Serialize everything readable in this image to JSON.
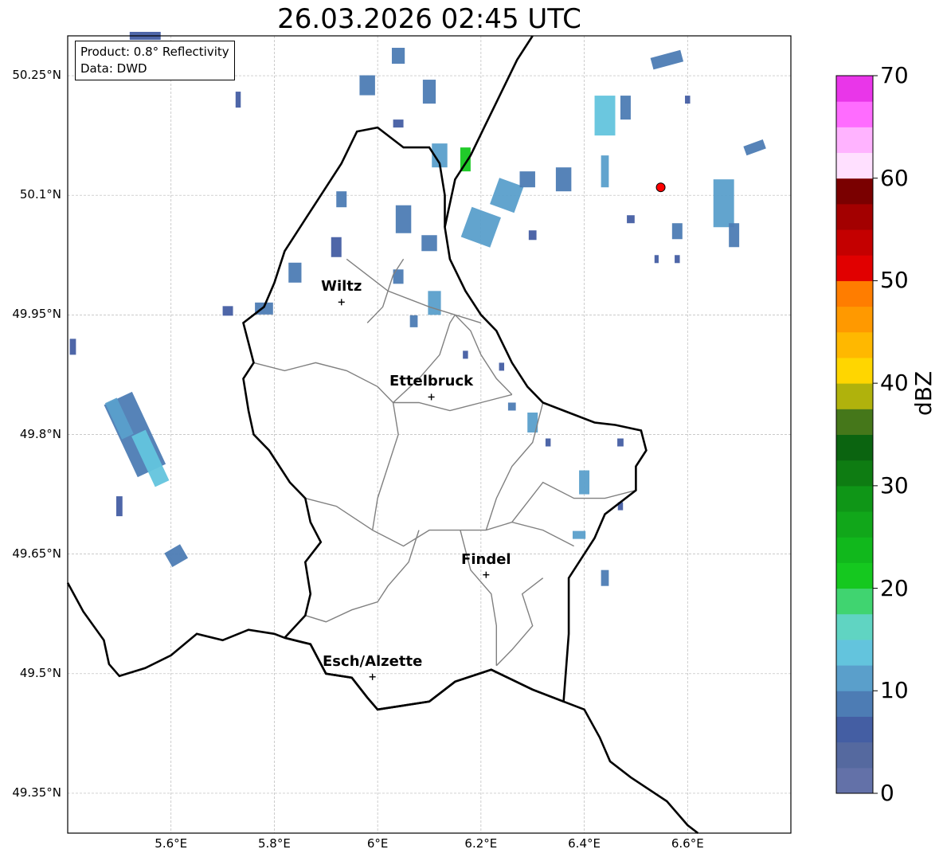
{
  "title": "26.03.2026 02:45 UTC",
  "info": {
    "product": "Product: 0.8° Reflectivity",
    "data": "Data: DWD"
  },
  "map": {
    "lon_range": [
      5.4,
      6.8
    ],
    "lat_range": [
      49.3,
      50.3
    ],
    "lat_ticks": [
      {
        "value": 50.25,
        "label": "50.25°N"
      },
      {
        "value": 50.1,
        "label": "50.1°N"
      },
      {
        "value": 49.95,
        "label": "49.95°N"
      },
      {
        "value": 49.8,
        "label": "49.8°N"
      },
      {
        "value": 49.65,
        "label": "49.65°N"
      },
      {
        "value": 49.5,
        "label": "49.5°N"
      },
      {
        "value": 49.35,
        "label": "49.35°N"
      }
    ],
    "lon_ticks": [
      {
        "value": 5.6,
        "label": "5.6°E"
      },
      {
        "value": 5.8,
        "label": "5.8°E"
      },
      {
        "value": 6.0,
        "label": "6°E"
      },
      {
        "value": 6.2,
        "label": "6.2°E"
      },
      {
        "value": 6.4,
        "label": "6.4°E"
      },
      {
        "value": 6.6,
        "label": "6.6°E"
      }
    ],
    "towns": [
      {
        "name": "Wiltz",
        "lon": 5.93,
        "lat": 49.966
      },
      {
        "name": "Ettelbruck",
        "lon": 6.104,
        "lat": 49.847
      },
      {
        "name": "Findel",
        "lon": 6.21,
        "lat": 49.624
      },
      {
        "name": "Esch/Alzette",
        "lon": 5.99,
        "lat": 49.496
      }
    ],
    "radar_site": {
      "lon": 6.548,
      "lat": 50.11,
      "color": "#ff0000"
    },
    "national_border": [
      [
        5.4,
        49.614
      ],
      [
        5.43,
        49.578
      ],
      [
        5.47,
        49.542
      ],
      [
        5.48,
        49.512
      ],
      [
        5.5,
        49.497
      ],
      [
        5.55,
        49.507
      ],
      [
        5.6,
        49.523
      ],
      [
        5.65,
        49.55
      ],
      [
        5.7,
        49.542
      ],
      [
        5.75,
        49.555
      ],
      [
        5.8,
        49.55
      ],
      [
        5.82,
        49.545
      ],
      [
        5.87,
        49.537
      ],
      [
        5.9,
        49.5
      ],
      [
        5.95,
        49.495
      ],
      [
        5.98,
        49.47
      ],
      [
        6.0,
        49.455
      ],
      [
        6.05,
        49.46
      ],
      [
        6.1,
        49.465
      ],
      [
        6.15,
        49.49
      ],
      [
        6.22,
        49.505
      ],
      [
        6.3,
        49.48
      ],
      [
        6.36,
        49.465
      ],
      [
        6.4,
        49.455
      ],
      [
        6.43,
        49.42
      ],
      [
        6.45,
        49.39
      ],
      [
        6.49,
        49.37
      ],
      [
        6.56,
        49.34
      ],
      [
        6.6,
        49.31
      ],
      [
        6.62,
        49.3
      ]
    ],
    "lux_border": [
      [
        5.82,
        49.545
      ],
      [
        5.86,
        49.573
      ],
      [
        5.87,
        49.6
      ],
      [
        5.86,
        49.64
      ],
      [
        5.89,
        49.665
      ],
      [
        5.87,
        49.69
      ],
      [
        5.86,
        49.72
      ],
      [
        5.83,
        49.74
      ],
      [
        5.79,
        49.78
      ],
      [
        5.76,
        49.8
      ],
      [
        5.75,
        49.83
      ],
      [
        5.74,
        49.87
      ],
      [
        5.76,
        49.89
      ],
      [
        5.74,
        49.94
      ],
      [
        5.78,
        49.96
      ],
      [
        5.8,
        49.99
      ],
      [
        5.82,
        50.03
      ],
      [
        5.86,
        50.07
      ],
      [
        5.89,
        50.1
      ],
      [
        5.93,
        50.14
      ],
      [
        5.96,
        50.18
      ],
      [
        6.0,
        50.185
      ],
      [
        6.05,
        50.16
      ],
      [
        6.1,
        50.16
      ],
      [
        6.12,
        50.14
      ],
      [
        6.13,
        50.1
      ],
      [
        6.13,
        50.06
      ],
      [
        6.14,
        50.02
      ],
      [
        6.17,
        49.98
      ],
      [
        6.2,
        49.95
      ],
      [
        6.23,
        49.93
      ],
      [
        6.26,
        49.89
      ],
      [
        6.29,
        49.86
      ],
      [
        6.32,
        49.84
      ],
      [
        6.36,
        49.83
      ],
      [
        6.42,
        49.815
      ],
      [
        6.46,
        49.812
      ],
      [
        6.51,
        49.805
      ],
      [
        6.52,
        49.78
      ],
      [
        6.5,
        49.76
      ],
      [
        6.5,
        49.73
      ],
      [
        6.44,
        49.7
      ],
      [
        6.42,
        49.67
      ],
      [
        6.37,
        49.62
      ],
      [
        6.37,
        49.58
      ],
      [
        6.37,
        49.55
      ],
      [
        6.36,
        49.465
      ],
      [
        6.3,
        49.48
      ],
      [
        6.22,
        49.505
      ],
      [
        6.15,
        49.49
      ],
      [
        6.1,
        49.465
      ],
      [
        6.05,
        49.46
      ],
      [
        6.0,
        49.455
      ],
      [
        5.98,
        49.47
      ],
      [
        5.95,
        49.495
      ],
      [
        5.9,
        49.5
      ],
      [
        5.87,
        49.537
      ],
      [
        5.82,
        49.545
      ]
    ],
    "de_be_border": [
      [
        6.13,
        50.06
      ],
      [
        6.15,
        50.12
      ],
      [
        6.18,
        50.15
      ],
      [
        6.21,
        50.19
      ],
      [
        6.24,
        50.23
      ],
      [
        6.27,
        50.27
      ],
      [
        6.3,
        50.3
      ]
    ],
    "cantons": [
      [
        [
          5.94,
          50.02
        ],
        [
          5.98,
          50.0
        ],
        [
          6.02,
          49.98
        ],
        [
          6.06,
          49.97
        ],
        [
          6.1,
          49.96
        ],
        [
          6.15,
          49.95
        ],
        [
          6.2,
          49.94
        ]
      ],
      [
        [
          5.76,
          49.89
        ],
        [
          5.82,
          49.88
        ],
        [
          5.88,
          49.89
        ],
        [
          5.94,
          49.88
        ],
        [
          6.0,
          49.86
        ],
        [
          6.03,
          49.84
        ],
        [
          6.08,
          49.84
        ],
        [
          6.14,
          49.83
        ],
        [
          6.2,
          49.84
        ],
        [
          6.26,
          49.85
        ]
      ],
      [
        [
          6.03,
          49.84
        ],
        [
          6.04,
          49.8
        ],
        [
          6.02,
          49.76
        ],
        [
          6.0,
          49.72
        ],
        [
          5.99,
          49.68
        ],
        [
          6.05,
          49.66
        ],
        [
          6.1,
          49.68
        ],
        [
          6.16,
          49.68
        ],
        [
          6.21,
          49.68
        ],
        [
          6.26,
          49.69
        ],
        [
          6.32,
          49.68
        ],
        [
          6.38,
          49.66
        ]
      ],
      [
        [
          5.86,
          49.72
        ],
        [
          5.92,
          49.71
        ],
        [
          5.99,
          49.68
        ]
      ],
      [
        [
          6.08,
          49.68
        ],
        [
          6.06,
          49.64
        ],
        [
          6.02,
          49.61
        ],
        [
          6.0,
          49.59
        ],
        [
          5.95,
          49.58
        ],
        [
          5.9,
          49.565
        ],
        [
          5.86,
          49.573
        ]
      ],
      [
        [
          6.16,
          49.68
        ],
        [
          6.18,
          49.63
        ],
        [
          6.22,
          49.6
        ],
        [
          6.23,
          49.56
        ],
        [
          6.23,
          49.51
        ]
      ],
      [
        [
          6.26,
          49.69
        ],
        [
          6.32,
          49.74
        ],
        [
          6.38,
          49.72
        ],
        [
          6.44,
          49.72
        ],
        [
          6.5,
          49.73
        ]
      ],
      [
        [
          6.21,
          49.68
        ],
        [
          6.23,
          49.72
        ],
        [
          6.26,
          49.76
        ],
        [
          6.3,
          49.79
        ],
        [
          6.32,
          49.84
        ]
      ],
      [
        [
          6.03,
          49.84
        ],
        [
          6.08,
          49.87
        ],
        [
          6.12,
          49.9
        ],
        [
          6.14,
          49.94
        ],
        [
          6.15,
          49.95
        ]
      ],
      [
        [
          5.98,
          49.94
        ],
        [
          6.01,
          49.96
        ],
        [
          6.03,
          50.0
        ],
        [
          6.05,
          50.02
        ]
      ],
      [
        [
          6.15,
          49.95
        ],
        [
          6.18,
          49.93
        ],
        [
          6.2,
          49.9
        ],
        [
          6.23,
          49.87
        ],
        [
          6.26,
          49.85
        ]
      ],
      [
        [
          6.32,
          49.62
        ],
        [
          6.28,
          49.6
        ],
        [
          6.3,
          49.56
        ],
        [
          6.26,
          49.53
        ],
        [
          6.23,
          49.51
        ]
      ]
    ],
    "echoes": [
      {
        "lon": 5.53,
        "lat": 49.8,
        "w": 0.06,
        "h": 0.1,
        "a": -25,
        "dbz": 9
      },
      {
        "lon": 5.56,
        "lat": 49.77,
        "w": 0.03,
        "h": 0.07,
        "a": -25,
        "dbz": 13
      },
      {
        "lon": 5.5,
        "lat": 49.82,
        "w": 0.025,
        "h": 0.05,
        "a": -25,
        "dbz": 11
      },
      {
        "lon": 5.61,
        "lat": 49.648,
        "w": 0.035,
        "h": 0.02,
        "a": -30,
        "dbz": 8
      },
      {
        "lon": 5.5,
        "lat": 49.71,
        "w": 0.012,
        "h": 0.025,
        "a": 0,
        "dbz": 7
      },
      {
        "lon": 5.41,
        "lat": 49.91,
        "w": 0.012,
        "h": 0.02,
        "a": 0,
        "dbz": 6
      },
      {
        "lon": 5.73,
        "lat": 50.22,
        "w": 0.01,
        "h": 0.02,
        "a": 0,
        "dbz": 7
      },
      {
        "lon": 5.55,
        "lat": 50.3,
        "w": 0.06,
        "h": 0.01,
        "a": 0,
        "dbz": 7
      },
      {
        "lon": 5.78,
        "lat": 49.958,
        "w": 0.035,
        "h": 0.015,
        "a": 0,
        "dbz": 8
      },
      {
        "lon": 5.71,
        "lat": 49.955,
        "w": 0.02,
        "h": 0.012,
        "a": 0,
        "dbz": 7
      },
      {
        "lon": 5.84,
        "lat": 50.003,
        "w": 0.025,
        "h": 0.025,
        "a": 0,
        "dbz": 9
      },
      {
        "lon": 5.93,
        "lat": 50.095,
        "w": 0.02,
        "h": 0.02,
        "a": 0,
        "dbz": 8
      },
      {
        "lon": 5.92,
        "lat": 50.035,
        "w": 0.02,
        "h": 0.025,
        "a": 0,
        "dbz": 7
      },
      {
        "lon": 5.98,
        "lat": 50.238,
        "w": 0.03,
        "h": 0.025,
        "a": 0,
        "dbz": 8
      },
      {
        "lon": 6.04,
        "lat": 50.275,
        "w": 0.025,
        "h": 0.02,
        "a": 0,
        "dbz": 8
      },
      {
        "lon": 6.05,
        "lat": 50.07,
        "w": 0.03,
        "h": 0.035,
        "a": 0,
        "dbz": 9
      },
      {
        "lon": 6.04,
        "lat": 50.19,
        "w": 0.02,
        "h": 0.01,
        "a": 0,
        "dbz": 6
      },
      {
        "lon": 6.1,
        "lat": 50.23,
        "w": 0.025,
        "h": 0.03,
        "a": 0,
        "dbz": 8
      },
      {
        "lon": 6.12,
        "lat": 50.15,
        "w": 0.03,
        "h": 0.03,
        "a": 0,
        "dbz": 12
      },
      {
        "lon": 6.17,
        "lat": 50.145,
        "w": 0.02,
        "h": 0.03,
        "a": 0,
        "dbz": 22
      },
      {
        "lon": 6.1,
        "lat": 50.04,
        "w": 0.03,
        "h": 0.02,
        "a": 0,
        "dbz": 8
      },
      {
        "lon": 6.04,
        "lat": 49.998,
        "w": 0.02,
        "h": 0.018,
        "a": 0,
        "dbz": 8
      },
      {
        "lon": 6.11,
        "lat": 49.965,
        "w": 0.025,
        "h": 0.03,
        "a": 0,
        "dbz": 11
      },
      {
        "lon": 6.07,
        "lat": 49.942,
        "w": 0.015,
        "h": 0.015,
        "a": 0,
        "dbz": 9
      },
      {
        "lon": 6.2,
        "lat": 50.06,
        "w": 0.06,
        "h": 0.04,
        "a": 20,
        "dbz": 10
      },
      {
        "lon": 6.25,
        "lat": 50.1,
        "w": 0.05,
        "h": 0.035,
        "a": 20,
        "dbz": 12
      },
      {
        "lon": 6.29,
        "lat": 50.12,
        "w": 0.03,
        "h": 0.02,
        "a": 0,
        "dbz": 9
      },
      {
        "lon": 6.36,
        "lat": 50.12,
        "w": 0.03,
        "h": 0.03,
        "a": 0,
        "dbz": 8
      },
      {
        "lon": 6.3,
        "lat": 50.05,
        "w": 0.015,
        "h": 0.012,
        "a": 0,
        "dbz": 7
      },
      {
        "lon": 6.44,
        "lat": 50.2,
        "w": 0.04,
        "h": 0.05,
        "a": 0,
        "dbz": 14
      },
      {
        "lon": 6.48,
        "lat": 50.21,
        "w": 0.02,
        "h": 0.03,
        "a": 0,
        "dbz": 9
      },
      {
        "lon": 6.44,
        "lat": 50.13,
        "w": 0.015,
        "h": 0.04,
        "a": 0,
        "dbz": 11
      },
      {
        "lon": 6.56,
        "lat": 50.27,
        "w": 0.06,
        "h": 0.015,
        "a": -15,
        "dbz": 9
      },
      {
        "lon": 6.6,
        "lat": 50.22,
        "w": 0.01,
        "h": 0.01,
        "a": 0,
        "dbz": 7
      },
      {
        "lon": 6.73,
        "lat": 50.16,
        "w": 0.04,
        "h": 0.012,
        "a": -20,
        "dbz": 8
      },
      {
        "lon": 6.67,
        "lat": 50.09,
        "w": 0.04,
        "h": 0.06,
        "a": 0,
        "dbz": 10
      },
      {
        "lon": 6.69,
        "lat": 50.05,
        "w": 0.02,
        "h": 0.03,
        "a": 0,
        "dbz": 9
      },
      {
        "lon": 6.58,
        "lat": 50.055,
        "w": 0.02,
        "h": 0.02,
        "a": 0,
        "dbz": 8
      },
      {
        "lon": 6.49,
        "lat": 50.07,
        "w": 0.015,
        "h": 0.01,
        "a": 0,
        "dbz": 7
      },
      {
        "lon": 6.54,
        "lat": 50.02,
        "w": 0.008,
        "h": 0.01,
        "a": 0,
        "dbz": 6
      },
      {
        "lon": 6.58,
        "lat": 50.02,
        "w": 0.01,
        "h": 0.01,
        "a": 0,
        "dbz": 6
      },
      {
        "lon": 6.3,
        "lat": 49.815,
        "w": 0.02,
        "h": 0.025,
        "a": 0,
        "dbz": 12
      },
      {
        "lon": 6.26,
        "lat": 49.835,
        "w": 0.015,
        "h": 0.01,
        "a": 0,
        "dbz": 9
      },
      {
        "lon": 6.33,
        "lat": 49.79,
        "w": 0.01,
        "h": 0.01,
        "a": 0,
        "dbz": 7
      },
      {
        "lon": 6.4,
        "lat": 49.74,
        "w": 0.02,
        "h": 0.03,
        "a": 0,
        "dbz": 11
      },
      {
        "lon": 6.39,
        "lat": 49.674,
        "w": 0.025,
        "h": 0.01,
        "a": 0,
        "dbz": 12
      },
      {
        "lon": 6.44,
        "lat": 49.62,
        "w": 0.015,
        "h": 0.02,
        "a": 0,
        "dbz": 8
      },
      {
        "lon": 6.47,
        "lat": 49.79,
        "w": 0.012,
        "h": 0.01,
        "a": 0,
        "dbz": 7
      },
      {
        "lon": 6.47,
        "lat": 49.71,
        "w": 0.01,
        "h": 0.01,
        "a": 0,
        "dbz": 6
      },
      {
        "lon": 6.24,
        "lat": 49.885,
        "w": 0.01,
        "h": 0.01,
        "a": 0,
        "dbz": 7
      },
      {
        "lon": 6.17,
        "lat": 49.9,
        "w": 0.01,
        "h": 0.01,
        "a": 0,
        "dbz": 6
      }
    ]
  },
  "colorbar": {
    "label": "dBZ",
    "min": 0,
    "max": 70,
    "tick_labels": [
      {
        "value": 0,
        "label": "0"
      },
      {
        "value": 10,
        "label": "10"
      },
      {
        "value": 20,
        "label": "20"
      },
      {
        "value": 30,
        "label": "30"
      },
      {
        "value": 40,
        "label": "40"
      },
      {
        "value": 50,
        "label": "50"
      },
      {
        "value": 60,
        "label": "60"
      },
      {
        "value": 70,
        "label": "70"
      }
    ],
    "colors": [
      "#6371a8",
      "#55699f",
      "#445ea3",
      "#4d7cb4",
      "#5a9fcb",
      "#63c4dd",
      "#60d4c2",
      "#40d470",
      "#15c81f",
      "#11b81c",
      "#11a71a",
      "#0f9617",
      "#0e7c12",
      "#0b6410",
      "#45771a",
      "#b0b20c",
      "#ffd600",
      "#ffb800",
      "#ff9900",
      "#ff7d00",
      "#e10000",
      "#c40000",
      "#a30000",
      "#7a0000",
      "#ffe0ff",
      "#ffb3ff",
      "#ff6cff",
      "#e936e9"
    ]
  }
}
